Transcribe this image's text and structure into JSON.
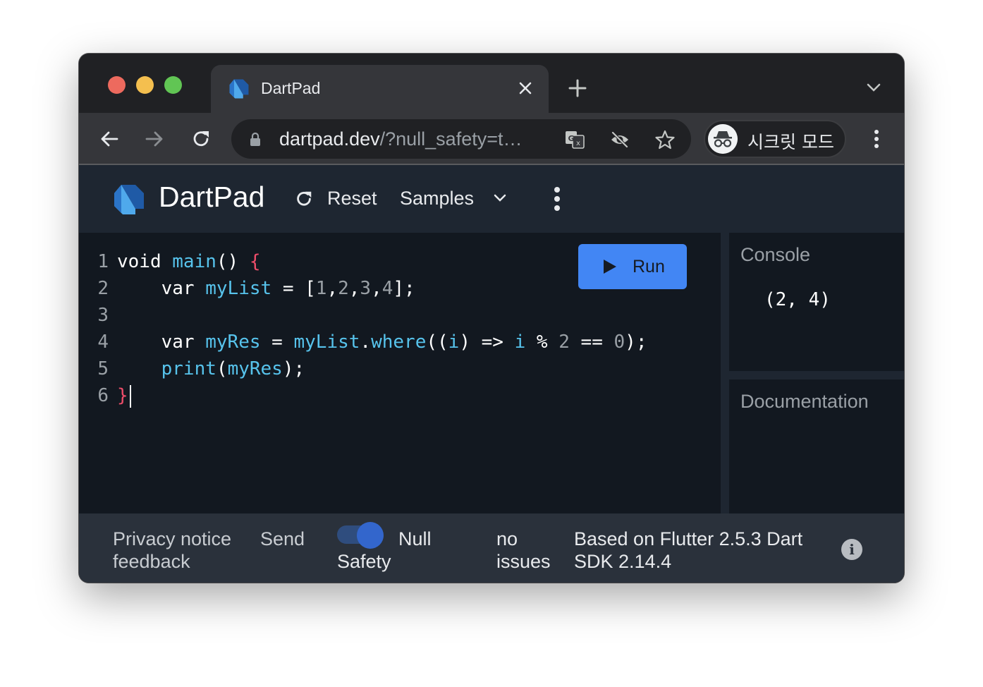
{
  "browser": {
    "tab": {
      "title": "DartPad",
      "favicon": "dart-logo-icon"
    },
    "omnibox": {
      "url_host": "dartpad.dev",
      "url_rest": "/?null_safety=t…"
    },
    "incognito": {
      "label": "시크릿 모드",
      "icon": "incognito-icon"
    },
    "icons": {
      "back": "arrow-left-icon",
      "forward": "arrow-right-icon",
      "reload": "reload-icon",
      "lock": "lock-icon",
      "translate": "translate-icon",
      "tracking": "eye-off-icon",
      "bookmark": "star-icon",
      "menu": "kebab-menu-icon",
      "new_tab": "plus-icon",
      "tab_search": "chevron-down-icon",
      "close_tab": "close-icon"
    }
  },
  "app": {
    "title": "DartPad",
    "reset_label": "Reset",
    "samples_label": "Samples",
    "run_label": "Run",
    "colors": {
      "run_button": "#4286f4",
      "keyword_fn": "#57c3ec",
      "brace": "#ee4d6a",
      "number": "#9aa0a6"
    }
  },
  "editor": {
    "lines": [
      {
        "num": "1"
      },
      {
        "num": "2"
      },
      {
        "num": "3"
      },
      {
        "num": "4"
      },
      {
        "num": "5"
      },
      {
        "num": "6"
      }
    ],
    "tokens": {
      "l1_void": "void ",
      "l1_main": "main",
      "l1_paren": "() ",
      "l1_brace": "{",
      "l2_indent": "    ",
      "l2_var": "var ",
      "l2_name": "myList",
      "l2_eq": " = [",
      "l2_n1": "1",
      "l2_c1": ",",
      "l2_n2": "2",
      "l2_c2": ",",
      "l2_n3": "3",
      "l2_c3": ",",
      "l2_n4": "4",
      "l2_end": "];",
      "l4_indent": "    ",
      "l4_var": "var ",
      "l4_name": "myRes",
      "l4_eq": " = ",
      "l4_list": "myList",
      "l4_dot": ".",
      "l4_where": "where",
      "l4_p1": "((",
      "l4_i1": "i",
      "l4_arrow": ") => ",
      "l4_i2": "i",
      "l4_mod": " % ",
      "l4_two": "2",
      "l4_eqeq": " == ",
      "l4_zero": "0",
      "l4_end": ");",
      "l5_indent": "    ",
      "l5_print": "print",
      "l5_p": "(",
      "l5_arg": "myRes",
      "l5_end": ");",
      "l6_brace": "}"
    }
  },
  "console": {
    "title": "Console",
    "output": "(2, 4)"
  },
  "documentation": {
    "title": "Documentation"
  },
  "footer": {
    "privacy": "Privacy notice",
    "feedback": "feedback",
    "send": "Send",
    "null_label": "Null",
    "safety_label": "Safety",
    "null_safety_enabled": true,
    "issues_line1": "no",
    "issues_line2": "issues",
    "version_line1": "Based on Flutter 2.5.3 Dart",
    "version_line2": "SDK 2.14.4"
  }
}
